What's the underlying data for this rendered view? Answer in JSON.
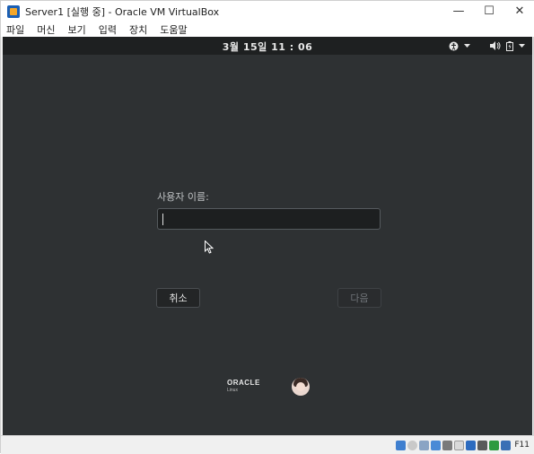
{
  "window": {
    "title": "Server1 [실행 중] - Oracle VM VirtualBox",
    "controls": {
      "minimize": "—",
      "maximize": "☐",
      "close": "✕"
    }
  },
  "menubar": {
    "items": [
      "파일",
      "머신",
      "보기",
      "입력",
      "장치",
      "도움말"
    ]
  },
  "guest": {
    "clock": "3월 15일 11 : 06",
    "tray": {
      "accessibility_icon": "accessibility-icon",
      "volume_icon": "volume-icon",
      "battery_icon": "battery-icon"
    },
    "login": {
      "username_label": "사용자 이름:",
      "username_value": "",
      "cancel_label": "취소",
      "next_label": "다음"
    },
    "branding": {
      "logo_text": "ORACLE",
      "logo_sub": "Linux"
    }
  },
  "statusbar": {
    "host_key": "F11",
    "icons": [
      "hdd-icon",
      "optical-icon",
      "audio-icon",
      "network-icon",
      "usb-icon",
      "shared-folder-icon",
      "display-icon",
      "recording-icon",
      "cpu-icon",
      "mouse-integration-icon"
    ]
  },
  "colors": {
    "guest_bg": "#2e3133",
    "topbar_bg": "#1e2021",
    "accent_blue": "#1b5fb4"
  }
}
